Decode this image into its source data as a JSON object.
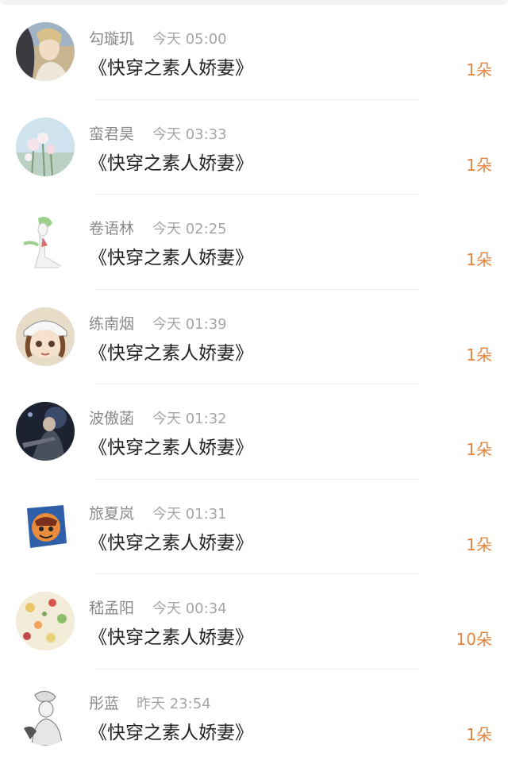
{
  "items": [
    {
      "name": "勾璇玑",
      "time": "今天 05:00",
      "title": "《快穿之素人娇妻》",
      "amount": "1朵",
      "avatar": "avatar-portrait-girl-icon"
    },
    {
      "name": "蛮君昊",
      "time": "今天 03:33",
      "title": "《快穿之素人娇妻》",
      "amount": "1朵",
      "avatar": "avatar-flowers-icon"
    },
    {
      "name": "卷语林",
      "time": "今天 02:25",
      "title": "《快穿之素人娇妻》",
      "amount": "1朵",
      "avatar": "avatar-gardevoir-icon"
    },
    {
      "name": "练南烟",
      "time": "今天 01:39",
      "title": "《快穿之素人娇妻》",
      "amount": "1朵",
      "avatar": "avatar-anime-cap-icon"
    },
    {
      "name": "波傲菡",
      "time": "今天 01:32",
      "title": "《快穿之素人娇妻》",
      "amount": "1朵",
      "avatar": "avatar-warrior-icon"
    },
    {
      "name": "旅夏岚",
      "time": "今天 01:31",
      "title": "《快穿之素人娇妻》",
      "amount": "1朵",
      "avatar": "avatar-cartoon-badge-icon"
    },
    {
      "name": "嵇孟阳",
      "time": "今天 00:34",
      "title": "《快穿之素人娇妻》",
      "amount": "10朵",
      "avatar": "avatar-food-pattern-icon"
    },
    {
      "name": "彤蓝",
      "time": "昨天 23:54",
      "title": "《快穿之素人娇妻》",
      "amount": "1朵",
      "avatar": "avatar-sketch-character-icon"
    }
  ],
  "colors": {
    "accent": "#e5843c",
    "name": "#8a8a8a",
    "time": "#a6a6a6",
    "title": "#222222"
  }
}
